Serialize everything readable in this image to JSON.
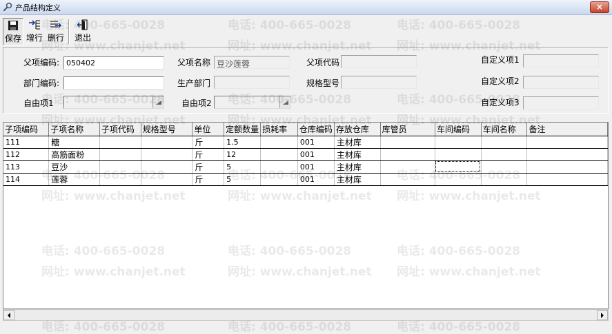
{
  "window": {
    "title": "产品结构定义",
    "close_label": "×"
  },
  "toolbar": {
    "save_label": "保存",
    "add_row_label": "增行",
    "delete_row_label": "删行",
    "exit_label": "退出"
  },
  "form": {
    "parent_code_label": "父项编码:",
    "parent_code_value": "050402",
    "parent_name_label": "父项名称",
    "parent_name_value": "豆沙莲蓉",
    "parent_alias_label": "父项代码",
    "parent_alias_value": "",
    "custom1_label": "自定义项1",
    "custom1_value": "",
    "dept_code_label": "部门编码:",
    "dept_code_value": "",
    "prod_dept_label": "生产部门",
    "prod_dept_value": "",
    "spec_label": "规格型号",
    "spec_value": "",
    "custom2_label": "自定义项2",
    "custom2_value": "",
    "free1_label": "自由项1",
    "free1_value": "",
    "free2_label": "自由项2",
    "free2_value": "",
    "custom3_label": "自定义项3",
    "custom3_value": ""
  },
  "grid": {
    "columns": [
      "子项编码",
      "子项名称",
      "子项代码",
      "规格型号",
      "单位",
      "定额数量",
      "损耗率",
      "仓库编码",
      "存放仓库",
      "库管员",
      "车间编码",
      "车间名称",
      "备注"
    ],
    "rows": [
      [
        "111",
        "糖",
        "",
        "",
        "斤",
        "1.5",
        "",
        "001",
        "主材库",
        "",
        "",
        "",
        ""
      ],
      [
        "112",
        "高筋面粉",
        "",
        "",
        "斤",
        "12",
        "",
        "001",
        "主材库",
        "",
        "",
        "",
        ""
      ],
      [
        "113",
        "豆沙",
        "",
        "",
        "斤",
        "5",
        "",
        "001",
        "主材库",
        "",
        "",
        "",
        ""
      ],
      [
        "114",
        "莲蓉",
        "",
        "",
        "斤",
        "5",
        "",
        "001",
        "主材库",
        "",
        "",
        "",
        ""
      ]
    ]
  },
  "watermark": {
    "phone": "电话: 400-665-0028",
    "site": "网址: www.chanjet.net"
  },
  "icons": {
    "app": "wrench-icon",
    "save": "floppy-disk-icon",
    "add_row": "add-row-icon",
    "delete_row": "delete-row-icon",
    "exit": "exit-door-icon"
  }
}
